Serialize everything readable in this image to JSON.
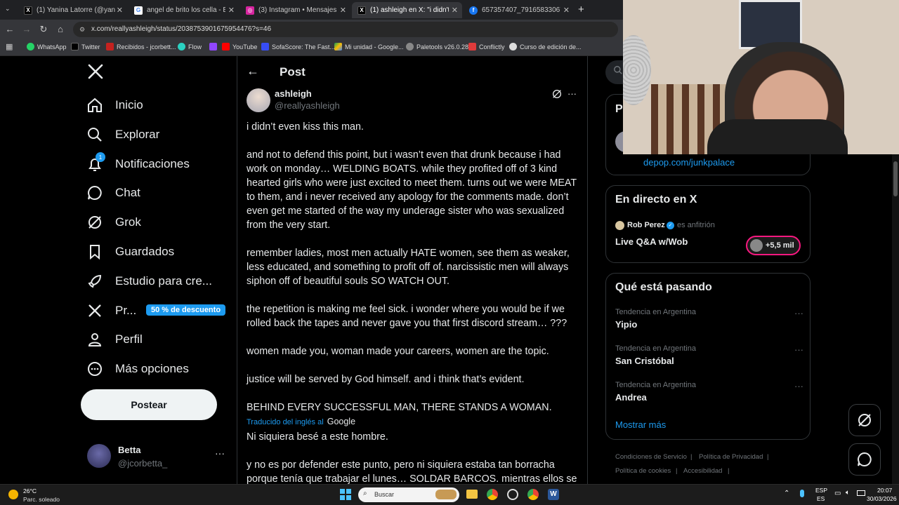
{
  "browser": {
    "tabs": [
      {
        "label": "(1) Yanina Latorre (@yanilatorre...",
        "favicon": "X"
      },
      {
        "label": "angel de brito los cella - Buscar",
        "favicon": "G"
      },
      {
        "label": "(3) Instagram • Mensajes",
        "favicon": "IG"
      },
      {
        "label": "(1) ashleigh en X: \"i didn't even...",
        "favicon": "X"
      },
      {
        "label": "657357407_791658330673015...",
        "favicon": "f"
      }
    ],
    "url": "x.com/reallyashleigh/status/2038753901675954476?s=46",
    "bookmarks": [
      "WhatsApp",
      "Twitter",
      "Recibidos - jcorbett...",
      "Flow",
      "YouTube",
      "SofaScore: The Fast...",
      "Mi unidad - Google...",
      "Paletools v26.0.28",
      "Conflictly",
      "Curso de edición de..."
    ]
  },
  "nav": {
    "items": [
      {
        "label": "Inicio",
        "icon": "home-icon"
      },
      {
        "label": "Explorar",
        "icon": "search-icon"
      },
      {
        "label": "Notificaciones",
        "icon": "bell-icon",
        "badge": "1"
      },
      {
        "label": "Chat",
        "icon": "chat-icon"
      },
      {
        "label": "Grok",
        "icon": "grok-icon"
      },
      {
        "label": "Guardados",
        "icon": "bookmark-icon"
      },
      {
        "label": "Estudio para cre...",
        "icon": "rocket-icon"
      },
      {
        "label": "Pr...",
        "icon": "x-premium-icon",
        "promo": "50 % de descuento"
      },
      {
        "label": "Perfil",
        "icon": "person-icon"
      },
      {
        "label": "Más opciones",
        "icon": "more-circle-icon"
      }
    ],
    "post_button": "Postear",
    "account": {
      "name": "Betta",
      "handle": "@jcorbetta_"
    }
  },
  "post": {
    "header": "Post",
    "author_name": "ashleigh",
    "author_handle": "@reallyashleigh",
    "paragraphs": [
      "i didn’t even kiss this man.",
      "and not to defend this point, but i wasn’t even that drunk because i had work on monday… WELDING BOATS. while they profited off of 3 kind hearted girls who were just excited to meet them. turns out we were MEAT to them, and i never received any apology for the comments made. don’t even get me started of the way my underage sister who was sexualized from the very start.",
      "remember ladies, most men actually HATE women, see them as weaker, less educated, and something to profit off of. narcissistic men will always siphon off of beautiful souls SO WATCH OUT.",
      "the repetition is making me feel sick. i wonder where you would be if we rolled back the tapes and never gave you that first discord stream… ???",
      "women made you, woman made your careers, women are the topic.",
      "justice will be served by God himself. and i think that’s evident.",
      "BEHIND EVERY SUCCESSFUL MAN, THERE STANDS A WOMAN."
    ],
    "translated_label": "Traducido del inglés al",
    "translated_brand": "Google",
    "translated_paragraphs": [
      "Ni siquiera besé a este hombre.",
      "y no es por defender este punto, pero ni siquiera estaba tan borracha porque tenía que trabajar el lunes… SOLDAR BARCOS. mientras ellos se"
    ]
  },
  "right": {
    "card_partial_letter": "P",
    "card_link": "depop.com/junkpalace",
    "live": {
      "title": "En directo en X",
      "host_name": "Rob Perez",
      "host_role": "es anfitrión",
      "space_title": "Live Q&A w/Wob",
      "listeners": "+5,5 mil"
    },
    "trends": {
      "title": "Qué está pasando",
      "items": [
        {
          "category": "Tendencia en Argentina",
          "name": "Yipio"
        },
        {
          "category": "Tendencia en Argentina",
          "name": "San Cristóbal"
        },
        {
          "category": "Tendencia en Argentina",
          "name": "Andrea"
        }
      ],
      "show_more": "Mostrar más"
    },
    "footer": [
      "Condiciones de Servicio",
      "Política de Privacidad",
      "Política de cookies",
      "Accesibilidad"
    ]
  },
  "taskbar": {
    "weather_temp": "26°C",
    "weather_desc": "Parc. soleado",
    "search_placeholder": "Buscar",
    "lang_top": "ESP",
    "lang_bottom": "ES",
    "time": "20:07",
    "date": "30/03/2026"
  },
  "colors": {
    "accent": "#1d9bf0",
    "background": "#000000",
    "border": "#2f3336",
    "muted": "#71767b"
  }
}
